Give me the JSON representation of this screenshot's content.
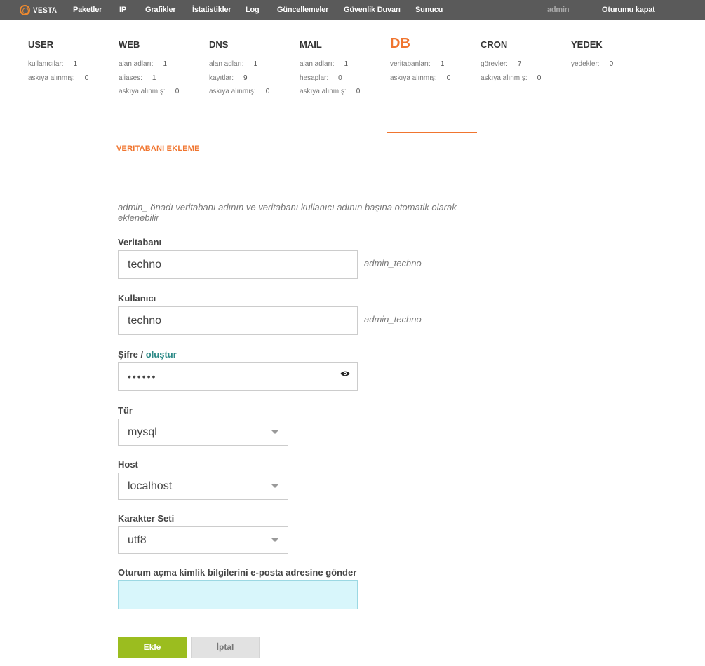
{
  "brand": {
    "logo_text": "VESTA",
    "accent": "#f0752f"
  },
  "nav": {
    "items": [
      "Paketler",
      "IP",
      "Grafikler",
      "İstatistikler",
      "Log",
      "Güncellemeler",
      "Güvenlik Duvarı",
      "Sunucu"
    ],
    "user": "admin",
    "logout": "Oturumu kapat"
  },
  "stats": [
    {
      "title": "USER",
      "rows": [
        {
          "label": "kullanıcılar:",
          "value": "1"
        },
        {
          "label": "askıya alınmış:",
          "value": "0"
        }
      ]
    },
    {
      "title": "WEB",
      "rows": [
        {
          "label": "alan adları:",
          "value": "1"
        },
        {
          "label": "aliases:",
          "value": "1"
        },
        {
          "label": "askıya alınmış:",
          "value": "0"
        }
      ]
    },
    {
      "title": "DNS",
      "rows": [
        {
          "label": "alan adları:",
          "value": "1"
        },
        {
          "label": "kayıtlar:",
          "value": "9"
        },
        {
          "label": "askıya alınmış:",
          "value": "0"
        }
      ]
    },
    {
      "title": "MAIL",
      "rows": [
        {
          "label": "alan adları:",
          "value": "1"
        },
        {
          "label": "hesaplar:",
          "value": "0"
        },
        {
          "label": "askıya alınmış:",
          "value": "0"
        }
      ]
    },
    {
      "title": "DB",
      "active": true,
      "rows": [
        {
          "label": "veritabanları:",
          "value": "1"
        },
        {
          "label": "askıya alınmış:",
          "value": "0"
        }
      ]
    },
    {
      "title": "CRON",
      "rows": [
        {
          "label": "görevler:",
          "value": "7"
        },
        {
          "label": "askıya alınmış:",
          "value": "0"
        }
      ]
    },
    {
      "title": "YEDEK",
      "rows": [
        {
          "label": "yedekler:",
          "value": "0"
        }
      ]
    }
  ],
  "page": {
    "section_title": "VERITABANI EKLEME"
  },
  "form": {
    "hint": "admin_ önadı veritabanı adının ve veritabanı kullanıcı adının başına otomatik olarak eklenebilir",
    "database": {
      "label": "Veritabanı",
      "value": "techno",
      "suffix": "admin_techno"
    },
    "user": {
      "label": "Kullanıcı",
      "value": "techno",
      "suffix": "admin_techno"
    },
    "password": {
      "label": "Şifre",
      "separator": " / ",
      "generate": "oluştur",
      "value": "••••••",
      "toggle_icon": "eye-icon"
    },
    "type": {
      "label": "Tür",
      "selected": "mysql"
    },
    "host": {
      "label": "Host",
      "selected": "localhost"
    },
    "charset": {
      "label": "Karakter Seti",
      "selected": "utf8"
    },
    "email": {
      "label": "Oturum açma kimlik bilgilerini e-posta adresine gönder",
      "value": ""
    },
    "buttons": {
      "add": "Ekle",
      "cancel": "İptal"
    }
  }
}
